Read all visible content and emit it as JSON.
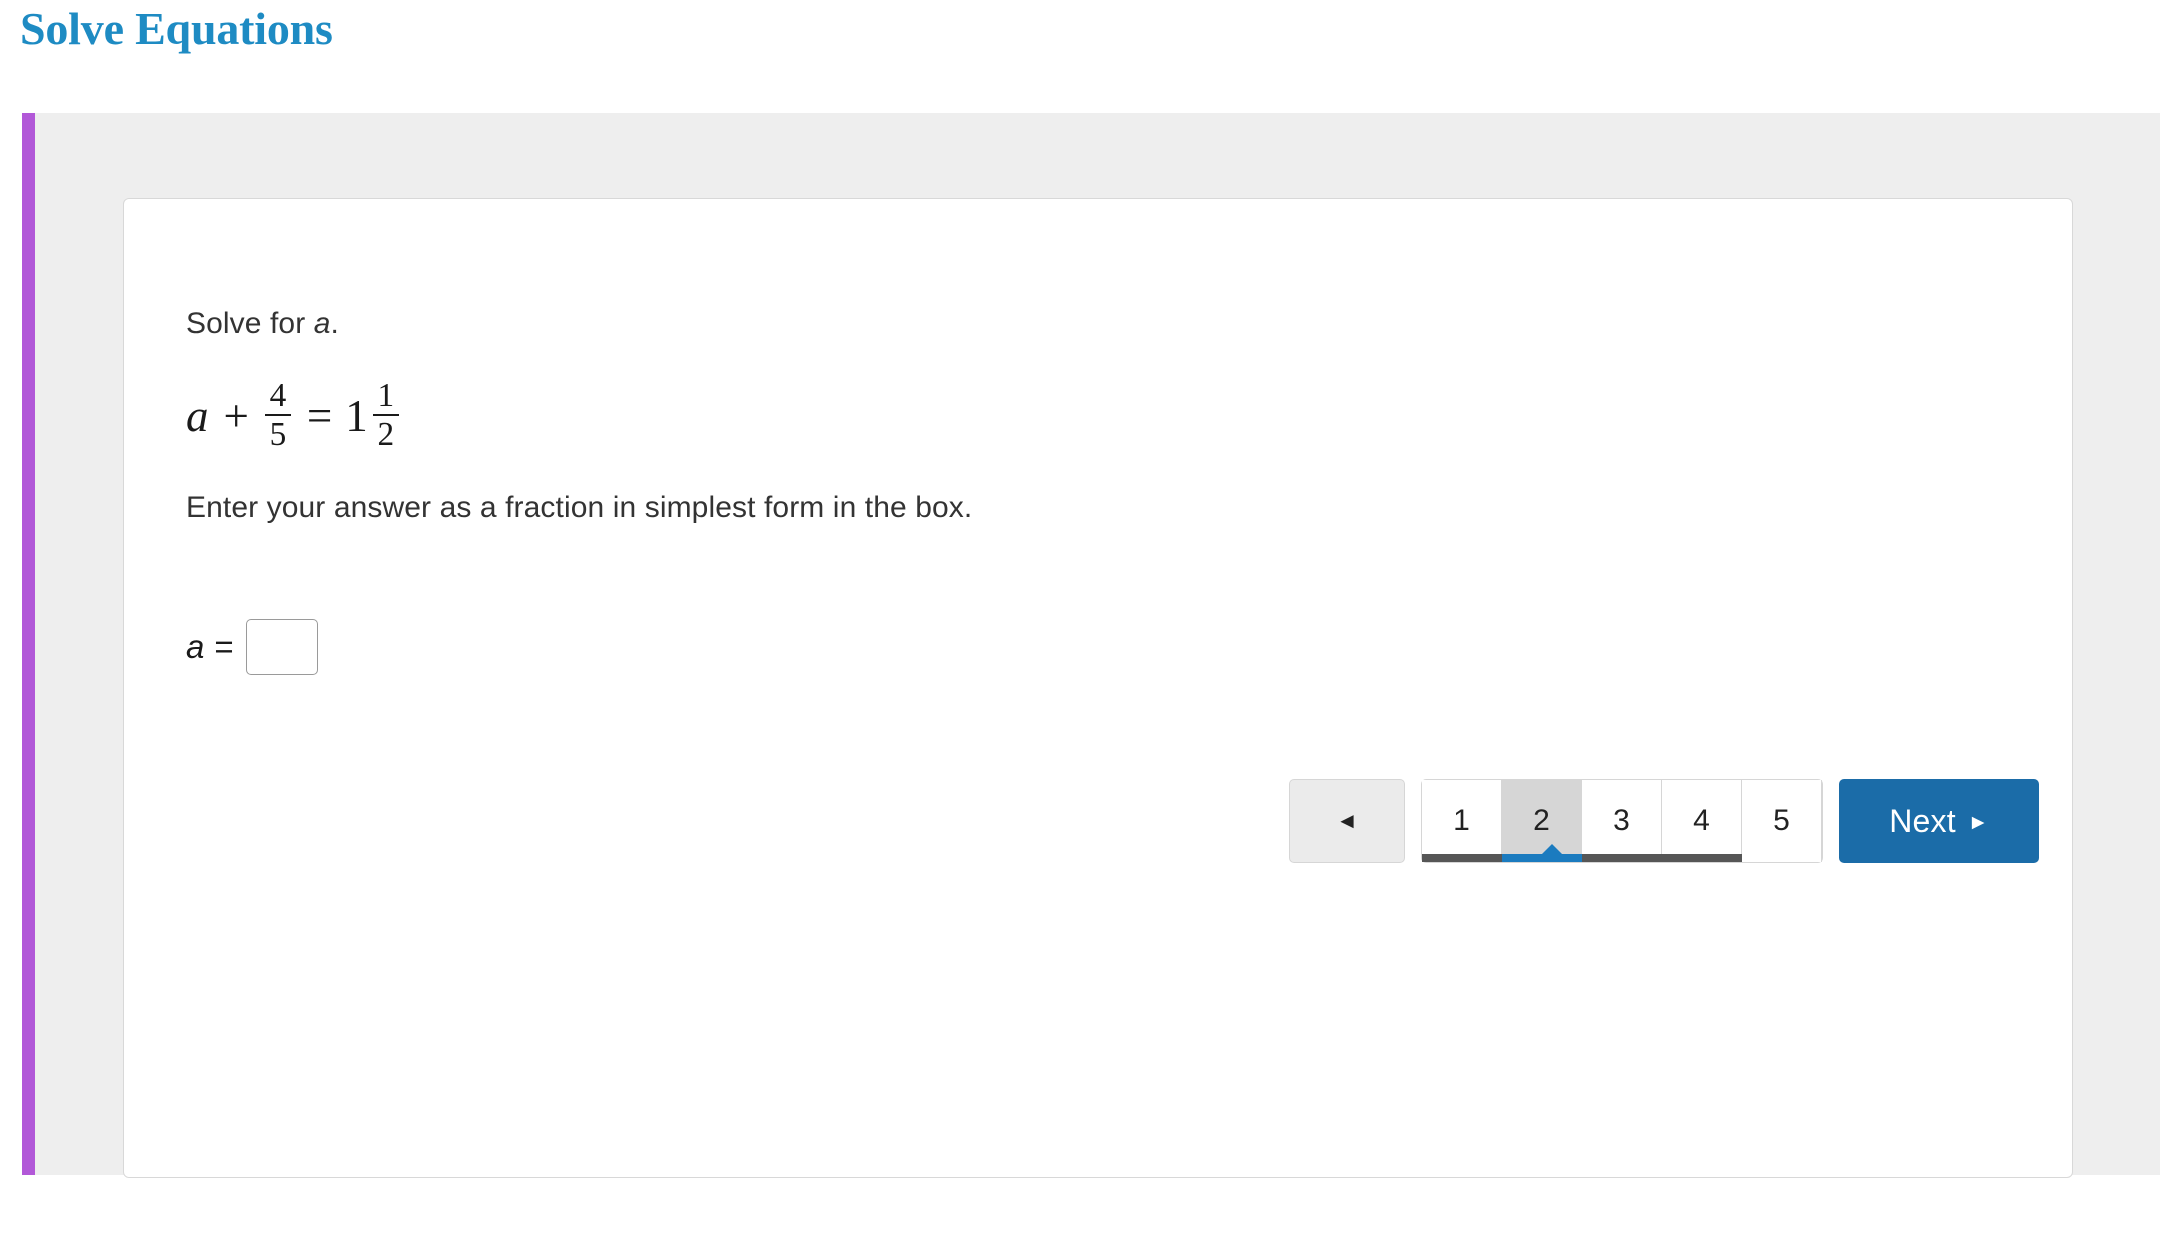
{
  "header": {
    "title": "Solve Equations",
    "title_color": "#1e8bc3"
  },
  "panel": {
    "accent_color": "#b258d8",
    "background_color": "#eeeeee"
  },
  "question": {
    "prompt_prefix": "Solve for ",
    "prompt_variable": "a",
    "prompt_suffix": ".",
    "equation": {
      "plain": "a + 4/5 = 1 1/2",
      "left_variable": "a",
      "plus_operator": "+",
      "left_fraction": {
        "numerator": "4",
        "denominator": "5"
      },
      "equals_operator": "=",
      "right_whole": "1",
      "right_fraction": {
        "numerator": "1",
        "denominator": "2"
      }
    },
    "instruction": "Enter your answer as a fraction in simplest form in the box.",
    "answer": {
      "variable": "a",
      "equals": "=",
      "value": "",
      "placeholder": ""
    }
  },
  "pagination": {
    "prev_icon": "triangle-left-icon",
    "prev_label": "◄",
    "pages": [
      {
        "label": "1",
        "state": "done"
      },
      {
        "label": "2",
        "state": "current"
      },
      {
        "label": "3",
        "state": "done"
      },
      {
        "label": "4",
        "state": "done"
      },
      {
        "label": "5",
        "state": "empty"
      }
    ],
    "current_page": "2",
    "next_label": "Next",
    "next_icon": "triangle-right-icon",
    "next_arrow": "►",
    "next_color": "#1b6ca8",
    "active_marker_color": "#1b7bbf",
    "done_marker_color": "#565656"
  }
}
